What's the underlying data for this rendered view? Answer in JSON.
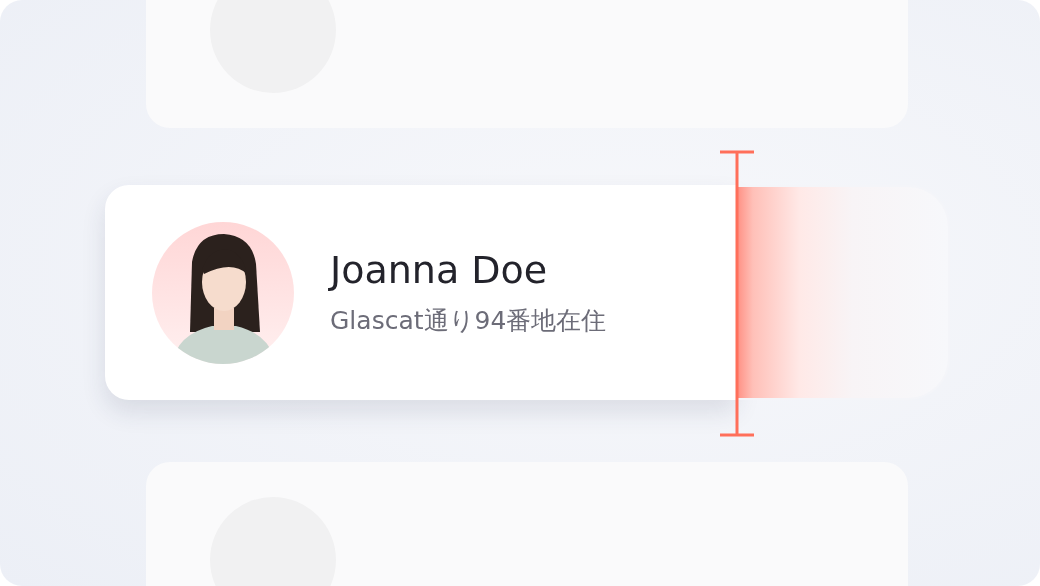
{
  "profile": {
    "name": "Joanna Doe",
    "address": "Glascat通り94番地在住"
  }
}
